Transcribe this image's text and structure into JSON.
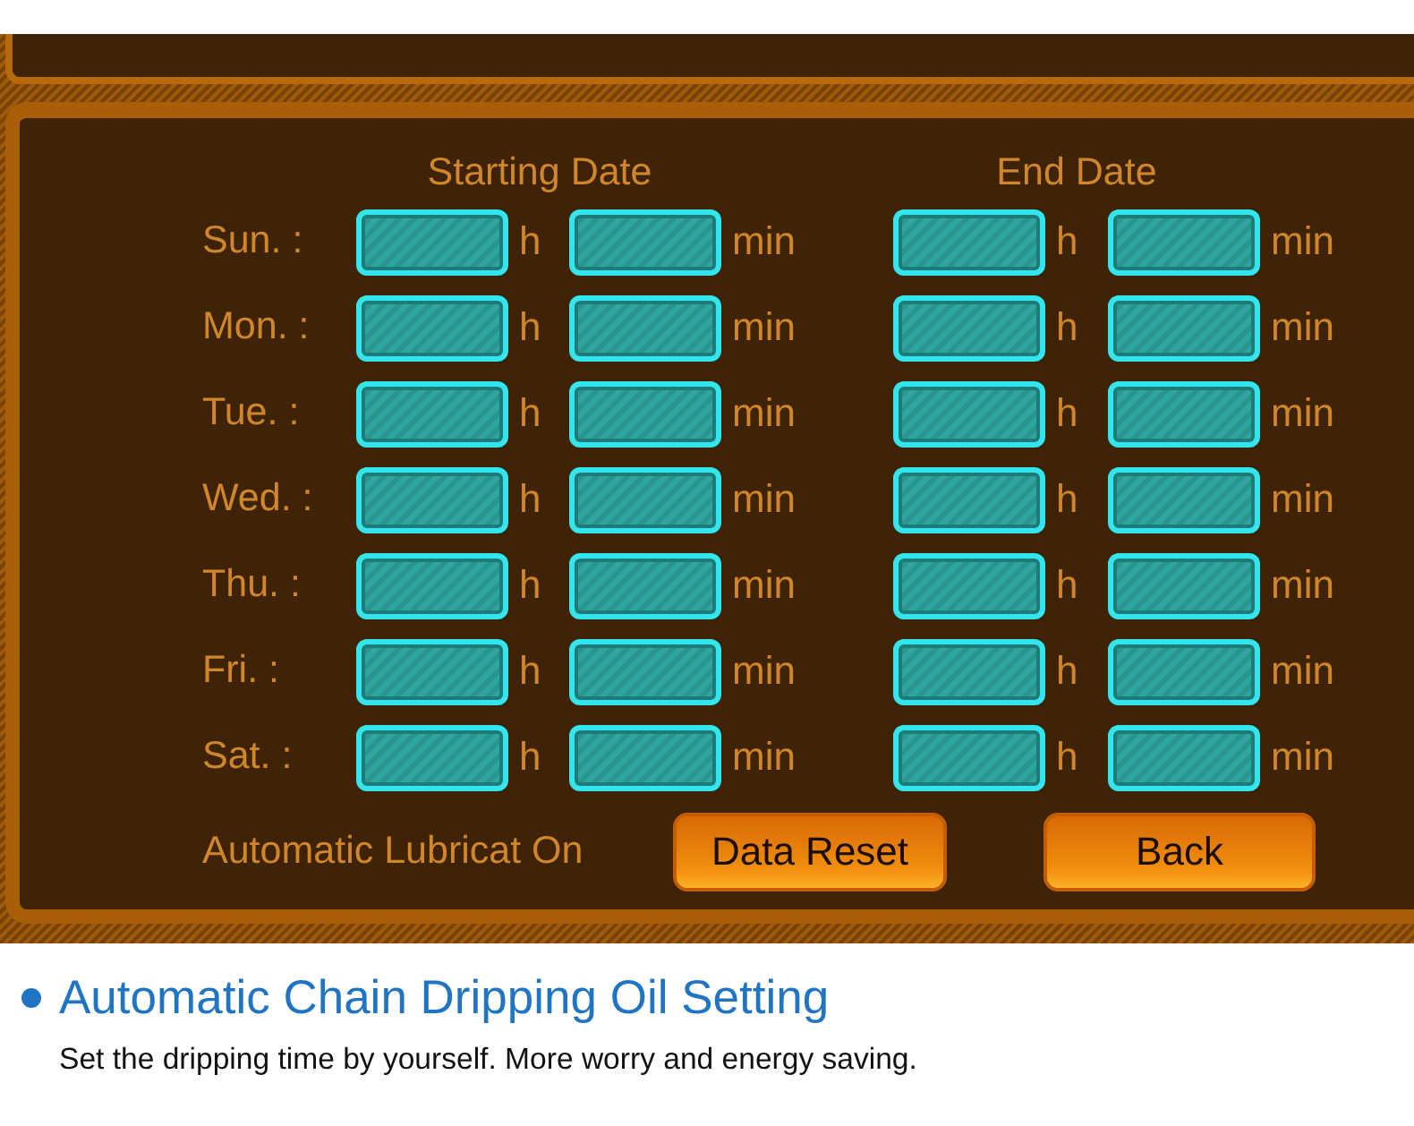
{
  "screen": {
    "headings": [
      "Starting Date",
      "End Date"
    ],
    "rows": [
      {
        "day": "Sun. :",
        "fields": [
          {
            "unit": "h"
          },
          {
            "unit": "min"
          },
          {
            "unit": "h"
          },
          {
            "unit": "min"
          }
        ]
      },
      {
        "day": "Mon. :",
        "fields": [
          {
            "unit": "h"
          },
          {
            "unit": "min"
          },
          {
            "unit": "h"
          },
          {
            "unit": "min"
          }
        ]
      },
      {
        "day": "Tue. :",
        "fields": [
          {
            "unit": "h"
          },
          {
            "unit": "min"
          },
          {
            "unit": "h"
          },
          {
            "unit": "min"
          }
        ]
      },
      {
        "day": "Wed. :",
        "fields": [
          {
            "unit": "h"
          },
          {
            "unit": "min"
          },
          {
            "unit": "h"
          },
          {
            "unit": "min"
          }
        ]
      },
      {
        "day": "Thu. :",
        "fields": [
          {
            "unit": "h"
          },
          {
            "unit": "min"
          },
          {
            "unit": "h"
          },
          {
            "unit": "min"
          }
        ]
      },
      {
        "day": "Fri. :",
        "fields": [
          {
            "unit": "h"
          },
          {
            "unit": "min"
          },
          {
            "unit": "h"
          },
          {
            "unit": "min"
          }
        ]
      },
      {
        "day": "Sat. :",
        "fields": [
          {
            "unit": "h"
          },
          {
            "unit": "min"
          },
          {
            "unit": "h"
          },
          {
            "unit": "min"
          }
        ]
      }
    ],
    "status": "Automatic Lubricat On",
    "buttons": [
      "Data Reset",
      "Back"
    ]
  },
  "caption": {
    "title": "Automatic Chain Dripping Oil Setting",
    "description": "Set the dripping time by yourself. More worry and energy saving."
  }
}
